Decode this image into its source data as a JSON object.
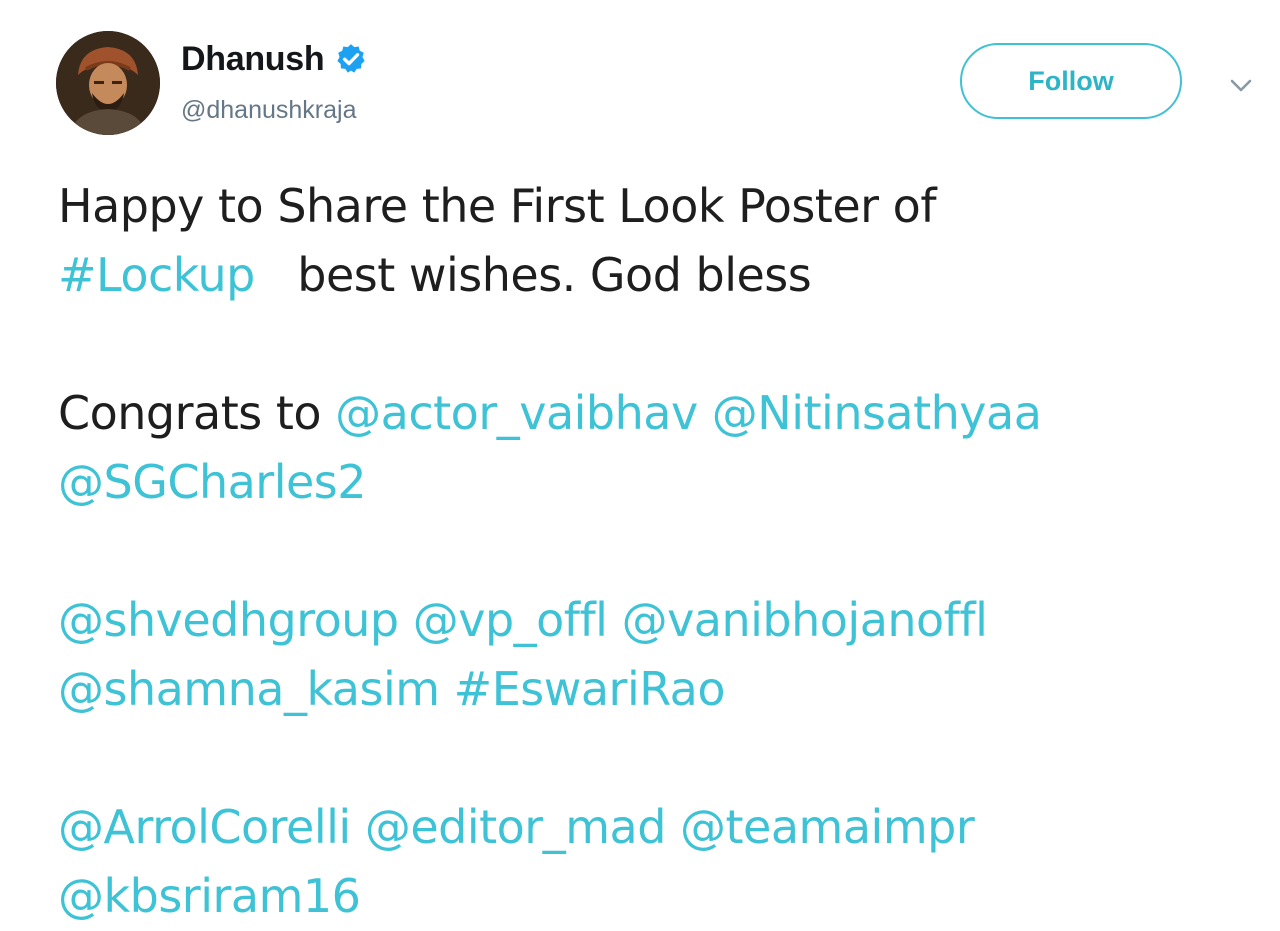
{
  "profile": {
    "display_name": "Dhanush",
    "handle": "@dhanushkraja",
    "verified": true,
    "avatar_icon": "profile-photo"
  },
  "header": {
    "follow_label": "Follow",
    "menu_icon": "chevron-down-icon"
  },
  "tweet": {
    "line1": "Happy to Share the First Look Poster  of",
    "line2_hashtag": "#Lockup",
    "line2_text": "   best wishes. God bless",
    "line3_text": "Congrats to ",
    "line3_mentions": "@actor_vaibhav @Nitinsathyaa",
    "line4": "@SGCharles2",
    "line5": "@shvedhgroup @vp_offl @vanibhojanoffl",
    "line6": "@shamna_kasim #EswariRao",
    "line7": "@ArrolCorelli @editor_mad @teamaimpr",
    "line8": "@kbsriram16"
  },
  "colors": {
    "link": "#3ec2d5",
    "follow_border": "#3fc1d3",
    "verified_badge": "#1da1f2",
    "handle": "#657786"
  }
}
